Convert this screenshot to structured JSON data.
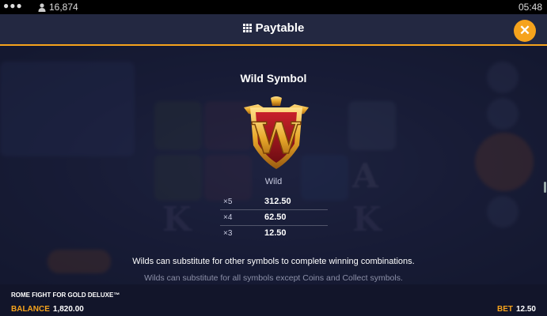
{
  "statusbar": {
    "menu_glyph": "●●●",
    "player_count": "16,874",
    "clock": "05:48"
  },
  "header": {
    "title": "Paytable",
    "close_glyph": "✕"
  },
  "symbol": {
    "title": "Wild Symbol",
    "name": "Wild",
    "emblem_letter": "W",
    "payouts": [
      {
        "multiplier": "×5",
        "value": "312.50"
      },
      {
        "multiplier": "×4",
        "value": "62.50"
      },
      {
        "multiplier": "×3",
        "value": "12.50"
      }
    ],
    "description": "Wilds can substitute for other symbols to complete winning combinations.",
    "note": "Wilds can substitute for all symbols except Coins and Collect symbols."
  },
  "footer": {
    "game_name": "ROME FIGHT FOR GOLD DELUXE™",
    "balance_label": "BALANCE",
    "balance_value": "1,820.00",
    "bet_label": "BET",
    "bet_value": "12.50"
  },
  "colors": {
    "accent": "#f6a31c",
    "background": "#161a30",
    "header": "#232841",
    "emblem_red": "#a3161c",
    "emblem_gold": "#e8a82a"
  }
}
